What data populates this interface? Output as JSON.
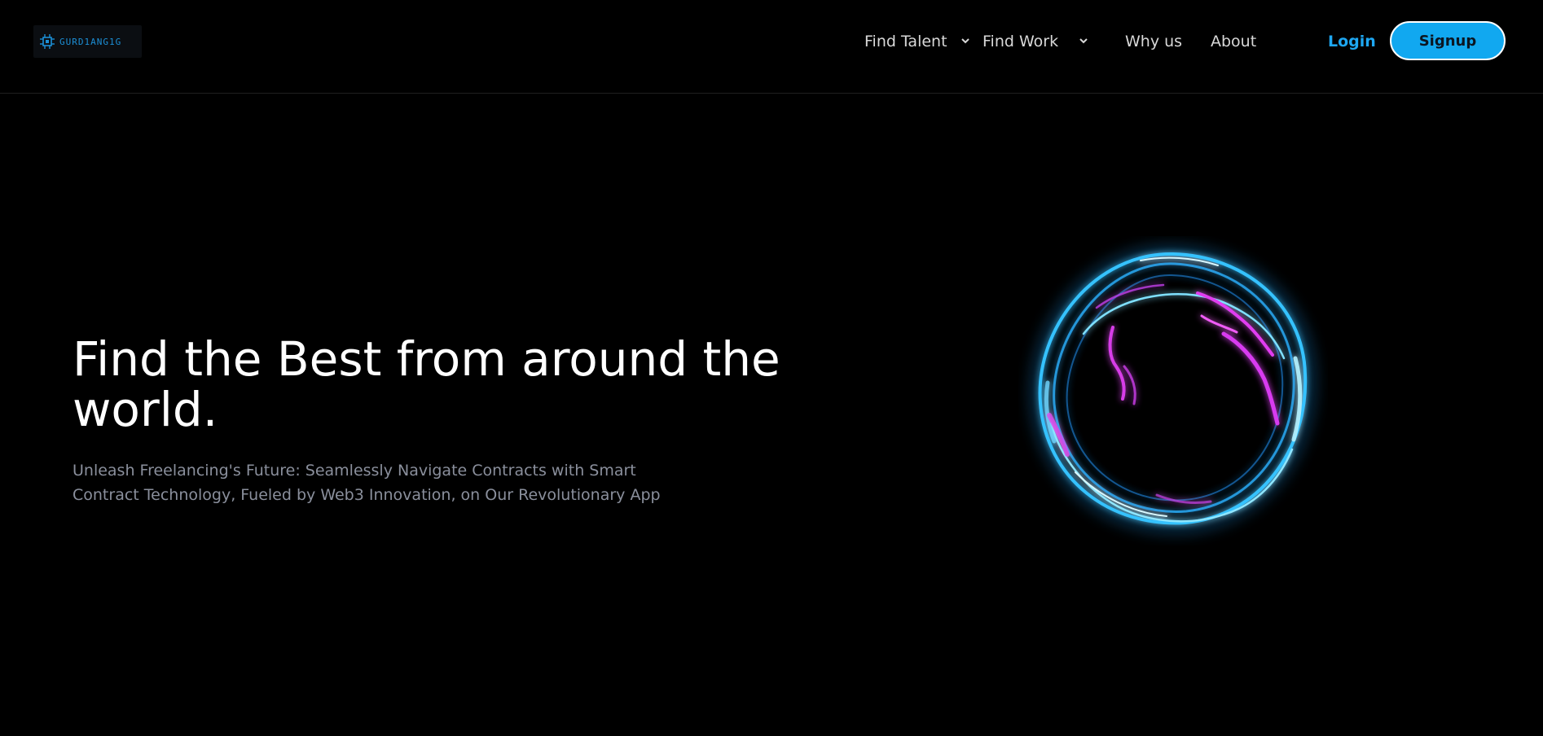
{
  "header": {
    "logo_text": "GURD1ANG1G",
    "logo_icon": "chip-icon",
    "nav": {
      "find_talent": "Find Talent",
      "find_work": "Find Work",
      "why_us": "Why us",
      "about": "About"
    },
    "login_label": "Login",
    "signup_label": "Signup"
  },
  "hero": {
    "title": "Find the Best from around the world.",
    "subtitle": "Unleash Freelancing's Future: Seamlessly Navigate Contracts with Smart Contract Technology, Fueled by Web3 Innovation, on Our Revolutionary App"
  },
  "colors": {
    "background": "#000000",
    "accent": "#11a8f0",
    "login": "#1ea7f2",
    "orb_blue": "#2fb8ff",
    "orb_magenta": "#e13cf0"
  }
}
